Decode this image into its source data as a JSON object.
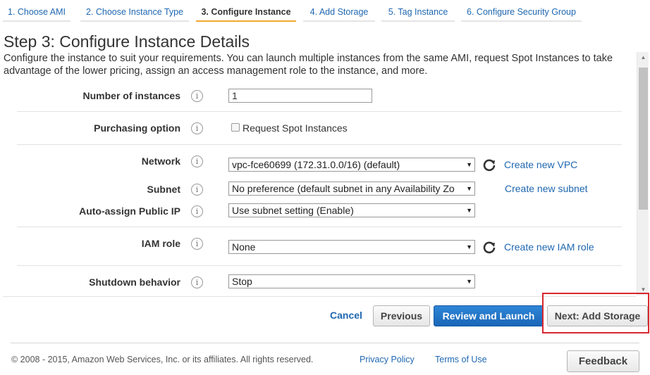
{
  "tabs": [
    {
      "label": "1. Choose AMI"
    },
    {
      "label": "2. Choose Instance Type"
    },
    {
      "label": "3. Configure Instance"
    },
    {
      "label": "4. Add Storage"
    },
    {
      "label": "5. Tag Instance"
    },
    {
      "label": "6. Configure Security Group"
    }
  ],
  "active_tab": "3. Configure Instance",
  "page": {
    "title": "Step 3: Configure Instance Details",
    "description": "Configure the instance to suit your requirements. You can launch multiple instances from the same AMI, request Spot Instances to take advantage of the lower pricing, assign an access management role to the instance, and more."
  },
  "form": {
    "number_of_instances": {
      "label": "Number of instances",
      "value": "1"
    },
    "purchasing_option": {
      "label": "Purchasing option",
      "checkbox_label": "Request Spot Instances",
      "checked": false
    },
    "network": {
      "label": "Network",
      "value": "vpc-fce60699 (172.31.0.0/16) (default)",
      "link": "Create new VPC"
    },
    "subnet": {
      "label": "Subnet",
      "value": "No preference (default subnet in any Availability Zo",
      "link": "Create new subnet"
    },
    "public_ip": {
      "label": "Auto-assign Public IP",
      "value": "Use subnet setting (Enable)"
    },
    "iam_role": {
      "label": "IAM role",
      "value": "None",
      "link": "Create new IAM role"
    },
    "shutdown": {
      "label": "Shutdown behavior",
      "value": "Stop"
    }
  },
  "actions": {
    "cancel": "Cancel",
    "previous": "Previous",
    "review": "Review and Launch",
    "next": "Next: Add Storage"
  },
  "footer": {
    "copyright": "© 2008 - 2015, Amazon Web Services, Inc. or its affiliates. All rights reserved.",
    "privacy": "Privacy Policy",
    "terms": "Terms of Use",
    "feedback": "Feedback"
  },
  "icons": {
    "info": "i",
    "refresh": "refresh-icon",
    "caret": "▼"
  },
  "colors": {
    "link": "#1f67b1",
    "active_tab_underline": "#f0a732",
    "primary_button": "#1a66b8",
    "highlight_border": "#d9272e"
  }
}
